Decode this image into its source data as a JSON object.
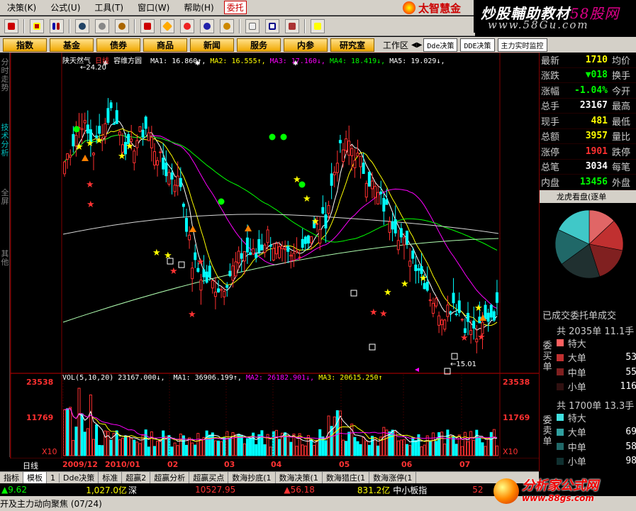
{
  "menu": {
    "items": [
      "决策(K)",
      "公式(U)",
      "工具(T)",
      "窗口(W)",
      "帮助(H)"
    ],
    "weituo": "委托",
    "brand": "太智慧金"
  },
  "watermark_top": {
    "line1_a": "炒股輔助教材",
    "line1_b": "58股网",
    "line2": "www.58Gu.com"
  },
  "nav": {
    "buttons": [
      "指数",
      "基金",
      "债券",
      "商品",
      "新闻",
      "服务",
      "内参",
      "研究室"
    ],
    "workspace": "工作区",
    "small": [
      "Dde决策",
      "DDE决策",
      "主力实时监控"
    ]
  },
  "left_tabs": [
    "分时走势",
    "技术分析",
    "全屏",
    "其他"
  ],
  "kline": {
    "stock": "陕天然气",
    "period": "日线",
    "indicator": "容维方圆",
    "ma": [
      {
        "label": "MA1: 16.860↑,",
        "color": "#ffffff"
      },
      {
        "label": "MA2: 16.555↑,",
        "color": "#ffff00"
      },
      {
        "label": "MA3: 17.160↓,",
        "color": "#ff00ff"
      },
      {
        "label": "MA4: 18.419↓,",
        "color": "#00ff00"
      },
      {
        "label": "MA5: 19.029↓,",
        "color": "#ffffff"
      }
    ],
    "high_label": "←24.20",
    "low_label": "←15.01"
  },
  "volume": {
    "title": "VOL(5,10,20)",
    "value": "23167.000↓,",
    "ma": [
      {
        "label": "MA1: 36906.199↑,",
        "color": "#ffffff"
      },
      {
        "label": "MA2: 26182.901↓,",
        "color": "#ff00ff"
      },
      {
        "label": "MA3: 20615.250↑",
        "color": "#ffff00"
      }
    ],
    "axis_top": "23538",
    "axis_mid": "11769",
    "axis_unit": "X10"
  },
  "x_axis": {
    "period": "日线",
    "labels": [
      "2009/12",
      "2010/01",
      "02",
      "03",
      "04",
      "05",
      "06",
      "07"
    ]
  },
  "bottom_tabs": [
    "指标",
    "模板",
    "1",
    "Dde决策",
    "标准",
    "超赢2",
    "超赢分析",
    "超赢买点",
    "数海抄底(1",
    "数海决策(1",
    "数海猎庄(1",
    "数海涨停(1"
  ],
  "statusbar": {
    "s1": "9.62",
    "s2": "1,027.0亿",
    "s3": "深",
    "s4": "10527.95",
    "s5": "56.18",
    "s6": "831.2亿",
    "s7": "中小板指",
    "s8": "52"
  },
  "ticker": "开及主力动向聚焦 (07/24)",
  "watermark_bottom": {
    "w1": "分析家公式网",
    "w2": "www.88gs.com"
  },
  "quote": {
    "rows": [
      {
        "l1": "最新",
        "v": "1710",
        "vc": "#ffff00",
        "l2": "均价"
      },
      {
        "l1": "涨跌",
        "v": "▼018",
        "vc": "#00ff00",
        "l2": "换手"
      },
      {
        "l1": "涨幅",
        "v": "-1.04%",
        "vc": "#00ff00",
        "l2": "今开"
      },
      {
        "l1": "总手",
        "v": "23167",
        "vc": "#ffffff",
        "l2": "最高"
      },
      {
        "l1": "现手",
        "v": "481",
        "vc": "#ffff00",
        "l2": "最低"
      },
      {
        "l1": "总额",
        "v": "3957",
        "vc": "#ffff00",
        "l2": "量比"
      },
      {
        "l1": "涨停",
        "v": "1901",
        "vc": "#ff3030",
        "l2": "跌停"
      },
      {
        "l1": "总笔",
        "v": "3034",
        "vc": "#ffffff",
        "l2": "每笔"
      },
      {
        "l1": "内盘",
        "v": "13456",
        "vc": "#00ff00",
        "l2": "外盘"
      }
    ],
    "lhb": "龙虎看盘(逐单",
    "pie_colors": [
      "#e06666",
      "#c03030",
      "#802020",
      "#203030",
      "#206868",
      "#40c8c8"
    ],
    "order_title": "已成交委托单成交",
    "buy": {
      "head": "共 2035单 11.1手",
      "side": "委买单",
      "rows": [
        {
          "label": "特大",
          "value": "",
          "color": "#ff6060"
        },
        {
          "label": "大单",
          "value": "53",
          "color": "#c03030"
        },
        {
          "label": "中单",
          "value": "55",
          "color": "#802020"
        },
        {
          "label": "小单",
          "value": "116",
          "color": "#301010"
        }
      ]
    },
    "sell": {
      "head": "共 1700单 13.3手",
      "side": "委卖单",
      "rows": [
        {
          "label": "特大",
          "value": "",
          "color": "#40e0e0"
        },
        {
          "label": "大单",
          "value": "69",
          "color": "#30a0a0"
        },
        {
          "label": "中单",
          "value": "58",
          "color": "#206868"
        },
        {
          "label": "小单",
          "value": "98",
          "color": "#103030"
        }
      ]
    }
  }
}
